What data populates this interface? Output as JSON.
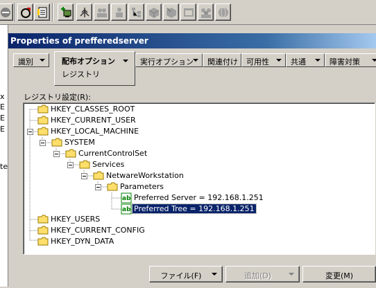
{
  "dialog": {
    "title": "Properties of prefferedserver"
  },
  "tabs": [
    {
      "label": "識別"
    },
    {
      "label": "配布オプション",
      "sub": "レジストリ",
      "active": true
    },
    {
      "label": "実行オプション"
    },
    {
      "label": "関連付け"
    },
    {
      "label": "可用性"
    },
    {
      "label": "共通"
    },
    {
      "label": "障害対策"
    }
  ],
  "registry": {
    "label": "レジストリ設定(R):",
    "tree": [
      {
        "label": "HKEY_CLASSES_ROOT"
      },
      {
        "label": "HKEY_CURRENT_USER"
      },
      {
        "label": "HKEY_LOCAL_MACHINE"
      },
      {
        "label": "SYSTEM"
      },
      {
        "label": "CurrentControlSet"
      },
      {
        "label": "Services"
      },
      {
        "label": "NetwareWorkstation"
      },
      {
        "label": "Parameters"
      },
      {
        "label": "Preferred Server = 192.168.1.251"
      },
      {
        "label": "Preferred Tree = 192.168.1.251"
      },
      {
        "label": "HKEY_USERS"
      },
      {
        "label": "HKEY_CURRENT_CONFIG"
      },
      {
        "label": "HKEY_DYN_DATA"
      }
    ]
  },
  "buttons": {
    "file": "ファイル(F)",
    "add": "追加(D)",
    "change": "変更(M)"
  },
  "left_strip": {
    "chars": [
      "x",
      "E",
      "E",
      "E",
      "te"
    ]
  },
  "toolbar": {
    "icons": [
      "red-circle-icon",
      "wizard-icon",
      "document-list-icon",
      "add-computer-icon",
      "tree-icon",
      "users-icon",
      "user-icon",
      "tree-small-icon",
      "cube-icon",
      "cube-arrow-icon",
      "window-icon",
      "group-icon",
      "globe-icon"
    ]
  },
  "colors": {
    "titlebar_start": "#0a246a",
    "titlebar_end": "#a6caf0",
    "selection": "#0a246a"
  }
}
